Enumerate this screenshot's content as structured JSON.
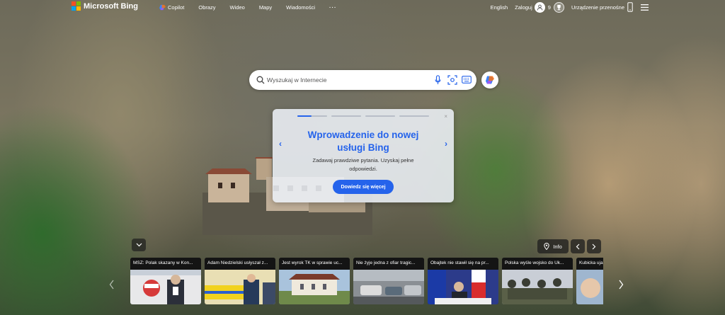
{
  "brand": {
    "name": "Microsoft Bing",
    "colors": [
      "#f25022",
      "#7fba00",
      "#00a4ef",
      "#ffb900"
    ]
  },
  "nav": {
    "items": [
      {
        "label": "Copilot",
        "icon": "copilot-icon"
      },
      {
        "label": "Obrazy"
      },
      {
        "label": "Wideo"
      },
      {
        "label": "Mapy"
      },
      {
        "label": "Wiadomości"
      },
      {
        "label": "···"
      }
    ]
  },
  "header_right": {
    "language": "English",
    "sign_in": "Zaloguj",
    "rewards_count": "9",
    "mobile_label": "Urządzenie przenośne"
  },
  "search": {
    "placeholder": "Wyszukaj w Internecie",
    "icons": [
      "search-icon",
      "microphone-icon",
      "visual-search-icon",
      "keyboard-icon"
    ]
  },
  "promo": {
    "title": "Wprowadzenie do nowej usługi Bing",
    "description": "Zadawaj prawdziwe pytania. Uzyskaj pełne odpowiedzi.",
    "button": "Dowiedz się więcej",
    "close": "×",
    "accent": "#2563eb",
    "slides": 4,
    "active_slide": 1
  },
  "bottom": {
    "info": "Info"
  },
  "news": [
    {
      "title": "MSZ: Polak skazany w Kon..."
    },
    {
      "title": "Adam Niedzielski usłyszał z..."
    },
    {
      "title": "Jest wyrok TK w sprawie uc..."
    },
    {
      "title": "Nie żyje jedna z ofiar tragic..."
    },
    {
      "title": "Obajtek nie stawił się na pr..."
    },
    {
      "title": "Polska wyśle wojsko do Uk..."
    },
    {
      "title": "Kubicka uja..."
    }
  ]
}
